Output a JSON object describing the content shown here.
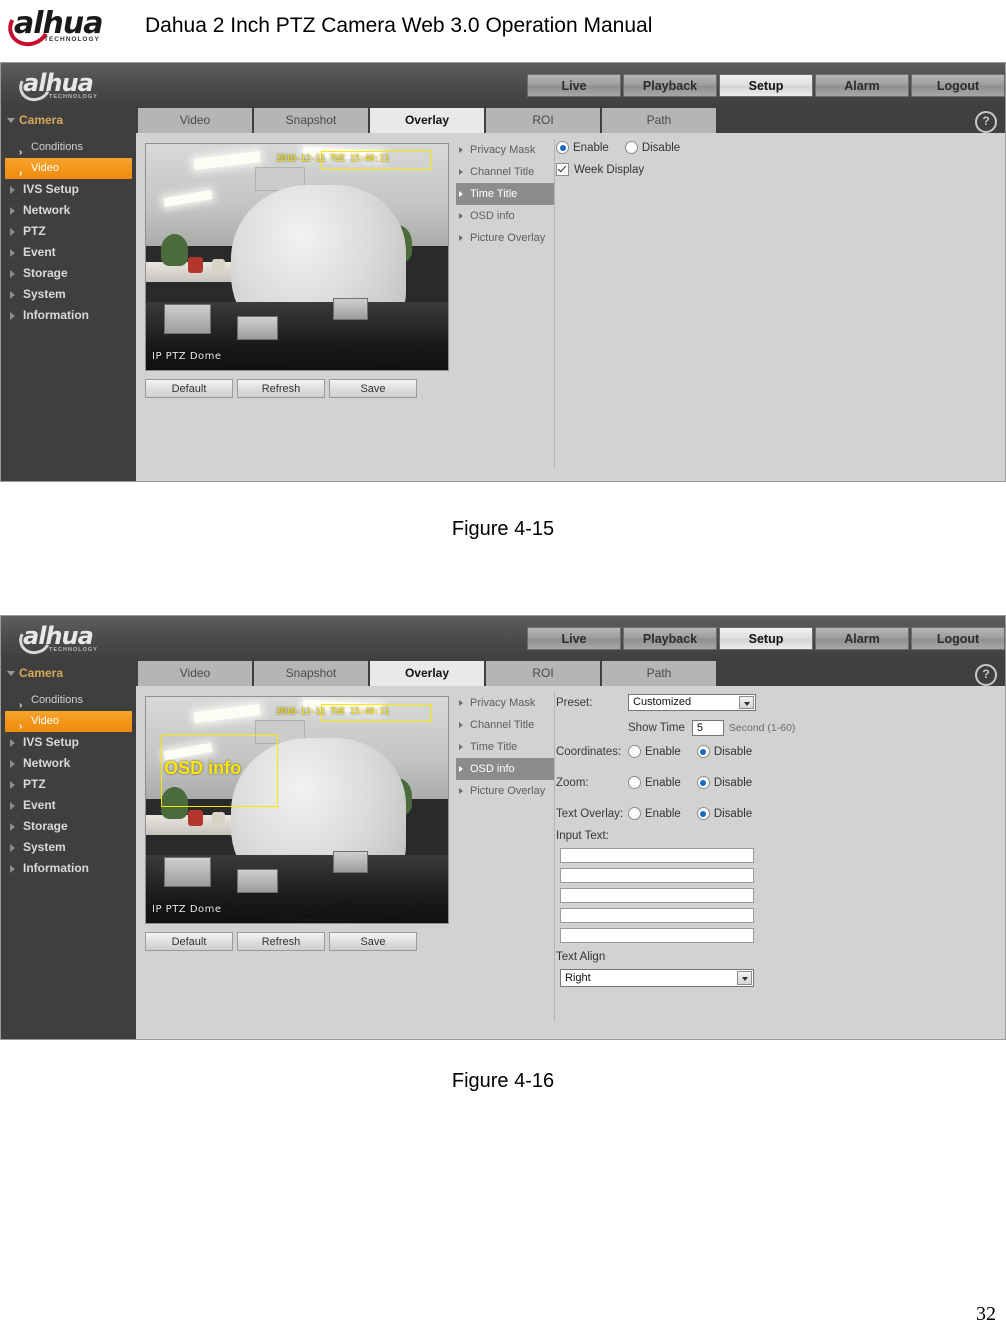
{
  "document": {
    "title": "Dahua 2 Inch PTZ Camera Web 3.0 Operation Manual",
    "brand": "alhua",
    "brand_tagline": "TECHNOLOGY",
    "page_number": "32"
  },
  "figures": [
    {
      "caption": "Figure 4-15",
      "app": {
        "brand": "alhua",
        "brand_tagline": "TECHNOLOGY",
        "nav_buttons": [
          {
            "label": "Live",
            "active": false
          },
          {
            "label": "Playback",
            "active": false
          },
          {
            "label": "Setup",
            "active": true
          },
          {
            "label": "Alarm",
            "active": false
          },
          {
            "label": "Logout",
            "active": false
          }
        ],
        "sidebar_header": "Camera",
        "sidebar_items": [
          {
            "label": "Conditions",
            "type": "sub",
            "selected": false
          },
          {
            "label": "Video",
            "type": "sub",
            "selected": true
          },
          {
            "label": "IVS Setup",
            "type": "top",
            "selected": false
          },
          {
            "label": "Network",
            "type": "top",
            "selected": false
          },
          {
            "label": "PTZ",
            "type": "top",
            "selected": false
          },
          {
            "label": "Event",
            "type": "top",
            "selected": false
          },
          {
            "label": "Storage",
            "type": "top",
            "selected": false
          },
          {
            "label": "System",
            "type": "top",
            "selected": false
          },
          {
            "label": "Information",
            "type": "top",
            "selected": false
          }
        ],
        "tabs": [
          {
            "label": "Video",
            "active": false
          },
          {
            "label": "Snapshot",
            "active": false
          },
          {
            "label": "Overlay",
            "active": true
          },
          {
            "label": "ROI",
            "active": false
          },
          {
            "label": "Path",
            "active": false
          }
        ],
        "help_icon": "?",
        "video": {
          "osd_time": "2016-12-11 TUE 15:40:11",
          "osd_channel": "IP PTZ Dome",
          "osd_label": ""
        },
        "buttons": [
          {
            "label": "Default"
          },
          {
            "label": "Refresh"
          },
          {
            "label": "Save"
          }
        ],
        "submenu": [
          {
            "label": "Privacy Mask",
            "active": false
          },
          {
            "label": "Channel Title",
            "active": false
          },
          {
            "label": "Time Title",
            "active": true
          },
          {
            "label": "OSD info",
            "active": false
          },
          {
            "label": "Picture Overlay",
            "active": false
          }
        ],
        "form": {
          "enable_label": "Enable",
          "disable_label": "Disable",
          "enable_selected": true,
          "week_display_label": "Week Display",
          "week_display_checked": true
        }
      }
    },
    {
      "caption": "Figure 4-16",
      "app": {
        "brand": "alhua",
        "brand_tagline": "TECHNOLOGY",
        "nav_buttons": [
          {
            "label": "Live",
            "active": false
          },
          {
            "label": "Playback",
            "active": false
          },
          {
            "label": "Setup",
            "active": true
          },
          {
            "label": "Alarm",
            "active": false
          },
          {
            "label": "Logout",
            "active": false
          }
        ],
        "sidebar_header": "Camera",
        "sidebar_items": [
          {
            "label": "Conditions",
            "type": "sub",
            "selected": false
          },
          {
            "label": "Video",
            "type": "sub",
            "selected": true
          },
          {
            "label": "IVS Setup",
            "type": "top",
            "selected": false
          },
          {
            "label": "Network",
            "type": "top",
            "selected": false
          },
          {
            "label": "PTZ",
            "type": "top",
            "selected": false
          },
          {
            "label": "Event",
            "type": "top",
            "selected": false
          },
          {
            "label": "Storage",
            "type": "top",
            "selected": false
          },
          {
            "label": "System",
            "type": "top",
            "selected": false
          },
          {
            "label": "Information",
            "type": "top",
            "selected": false
          }
        ],
        "tabs": [
          {
            "label": "Video",
            "active": false
          },
          {
            "label": "Snapshot",
            "active": false
          },
          {
            "label": "Overlay",
            "active": true
          },
          {
            "label": "ROI",
            "active": false
          },
          {
            "label": "Path",
            "active": false
          }
        ],
        "help_icon": "?",
        "video": {
          "osd_time": "2016-12-11 TUE 15:40:11",
          "osd_channel": "IP PTZ Dome",
          "osd_label": "OSD info"
        },
        "buttons": [
          {
            "label": "Default"
          },
          {
            "label": "Refresh"
          },
          {
            "label": "Save"
          }
        ],
        "submenu": [
          {
            "label": "Privacy Mask",
            "active": false
          },
          {
            "label": "Channel Title",
            "active": false
          },
          {
            "label": "Time Title",
            "active": false
          },
          {
            "label": "OSD info",
            "active": true
          },
          {
            "label": "Picture Overlay",
            "active": false
          }
        ],
        "form": {
          "preset_label": "Preset:",
          "preset_value": "Customized",
          "show_time_label": "Show Time",
          "show_time_value": "5",
          "show_time_unit": "Second (1-60)",
          "coordinates_label": "Coordinates:",
          "coordinates_enable": "Enable",
          "coordinates_disable": "Disable",
          "coordinates_selected": "Disable",
          "zoom_label": "Zoom:",
          "zoom_enable": "Enable",
          "zoom_disable": "Disable",
          "zoom_selected": "Disable",
          "text_overlay_label": "Text Overlay:",
          "text_overlay_enable": "Enable",
          "text_overlay_disable": "Disable",
          "text_overlay_selected": "Disable",
          "input_text_label": "Input Text:",
          "input_text_values": [
            "",
            "",
            "",
            "",
            ""
          ],
          "text_align_label": "Text Align",
          "text_align_value": "Right"
        }
      }
    }
  ]
}
